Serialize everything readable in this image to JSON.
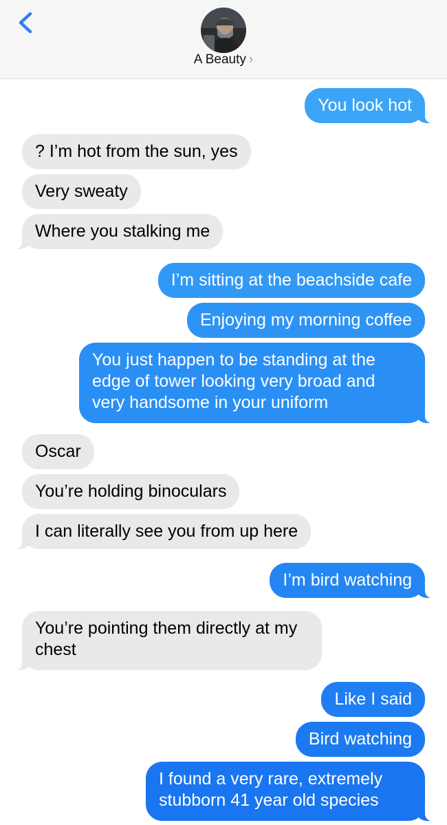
{
  "header": {
    "contact_name": "A Beauty",
    "chevron": "›",
    "back_icon": "chevron-left-icon",
    "accent_color": "#2f7cf6"
  },
  "messages": [
    {
      "dir": "out",
      "text": "You look hot",
      "color": "#3ba4f6"
    },
    {
      "dir": "in",
      "text": "? I’m hot from the sun, yes"
    },
    {
      "dir": "in",
      "text": "Very sweaty"
    },
    {
      "dir": "in",
      "text": "Where you stalking me"
    },
    {
      "dir": "out",
      "text": "I’m sitting at the beachside cafe",
      "color": "#3199f5"
    },
    {
      "dir": "out",
      "text": "Enjoying my morning coffee",
      "color": "#2d94f5"
    },
    {
      "dir": "out",
      "text": "You just happen to be standing at the edge of tower looking very broad and very handsome in your uniform",
      "color": "#2a8ff4"
    },
    {
      "dir": "in",
      "text": "Oscar"
    },
    {
      "dir": "in",
      "text": "You’re holding binoculars"
    },
    {
      "dir": "in",
      "text": "I can literally see you from up here"
    },
    {
      "dir": "out",
      "text": "I’m bird watching",
      "color": "#2486f3"
    },
    {
      "dir": "in",
      "text": "You’re pointing them directly at my chest"
    },
    {
      "dir": "out",
      "text": "Like I said",
      "color": "#1f7ef2"
    },
    {
      "dir": "out",
      "text": "Bird watching",
      "color": "#1c7af1"
    },
    {
      "dir": "out",
      "text": "I found a very rare, extremely stubborn 41 year old species",
      "color": "#1975f0"
    }
  ]
}
